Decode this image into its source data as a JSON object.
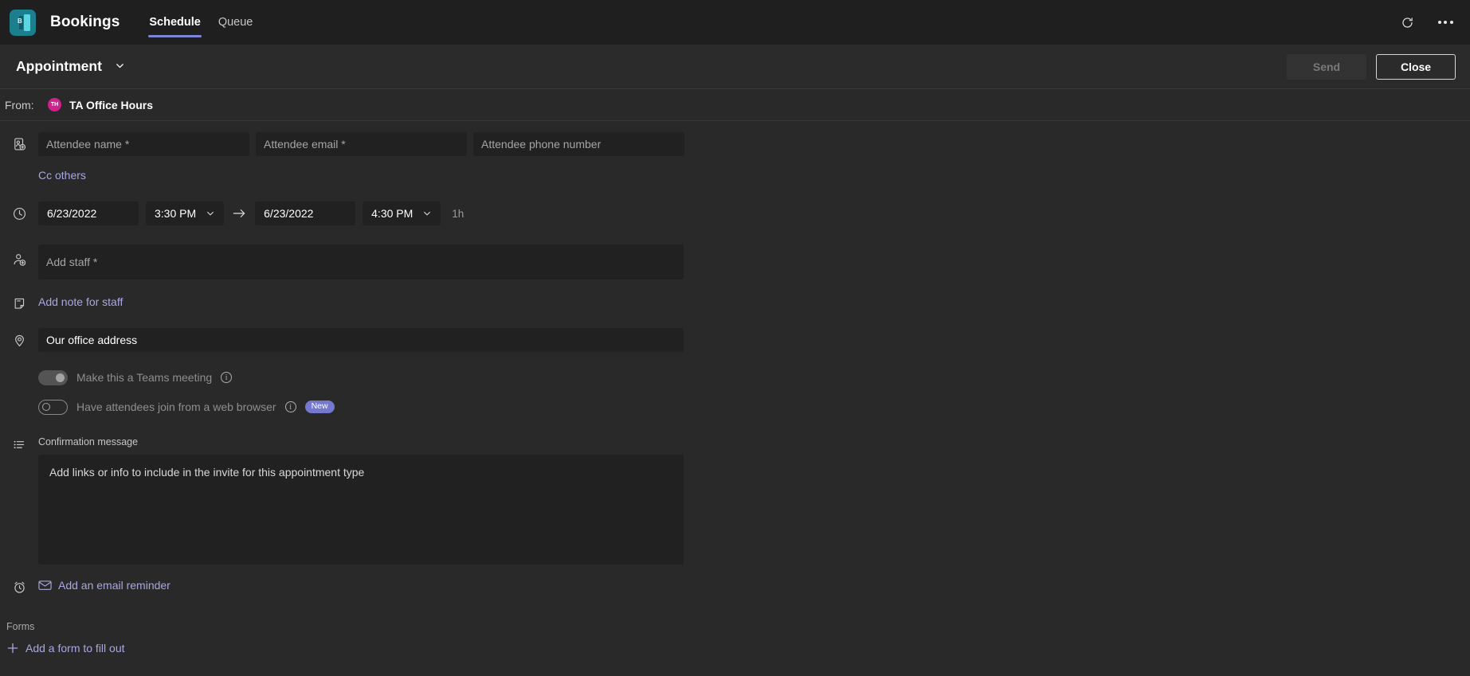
{
  "app": {
    "name": "Bookings",
    "logo_icon": "bookings-logo-icon",
    "logo_mark": "B",
    "tabs": [
      {
        "label": "Schedule",
        "active": true
      },
      {
        "label": "Queue",
        "active": false
      }
    ],
    "refresh_icon": "refresh-icon",
    "more_icon": "more-options-icon",
    "accent": "#7f85d6"
  },
  "command_bar": {
    "title": "Appointment",
    "chevron_icon": "chevron-down-icon",
    "send_label": "Send",
    "send_disabled": true,
    "close_label": "Close"
  },
  "from": {
    "label": "From:",
    "avatar_initials": "TH",
    "avatar_color": "#d0218f",
    "name": "TA Office Hours"
  },
  "attendees": {
    "icon": "contact-card-add-icon",
    "name_placeholder": "Attendee name *",
    "email_placeholder": "Attendee email *",
    "phone_placeholder": "Attendee phone number",
    "cc_link": "Cc others"
  },
  "datetime": {
    "icon": "clock-icon",
    "start_date": "6/23/2022",
    "start_time": "3:30 PM",
    "arrow_icon": "arrow-right-icon",
    "end_date": "6/23/2022",
    "end_time": "4:30 PM",
    "duration": "1h",
    "chevron_icon": "chevron-down-icon"
  },
  "staff": {
    "icon": "person-add-icon",
    "placeholder": "Add staff *",
    "note_icon": "note-icon",
    "note_link": "Add note for staff"
  },
  "location": {
    "icon": "location-pin-icon",
    "value": "Our office address"
  },
  "toggles": [
    {
      "label": "Make this a Teams meeting",
      "state": "off",
      "style": "filled",
      "info_icon": "info-icon",
      "badge": null
    },
    {
      "label": "Have attendees join from a web browser",
      "state": "off",
      "style": "outline",
      "info_icon": "info-icon",
      "badge": "New"
    }
  ],
  "confirmation": {
    "icon": "bulleted-list-icon",
    "label": "Confirmation message",
    "placeholder": "Add links or info to include in the invite for this appointment type"
  },
  "reminder": {
    "icon": "alarm-clock-icon",
    "mail_icon": "envelope-icon",
    "link": "Add an email reminder"
  },
  "forms": {
    "section_label": "Forms",
    "plus_icon": "plus-icon",
    "link": "Add a form to fill out"
  }
}
